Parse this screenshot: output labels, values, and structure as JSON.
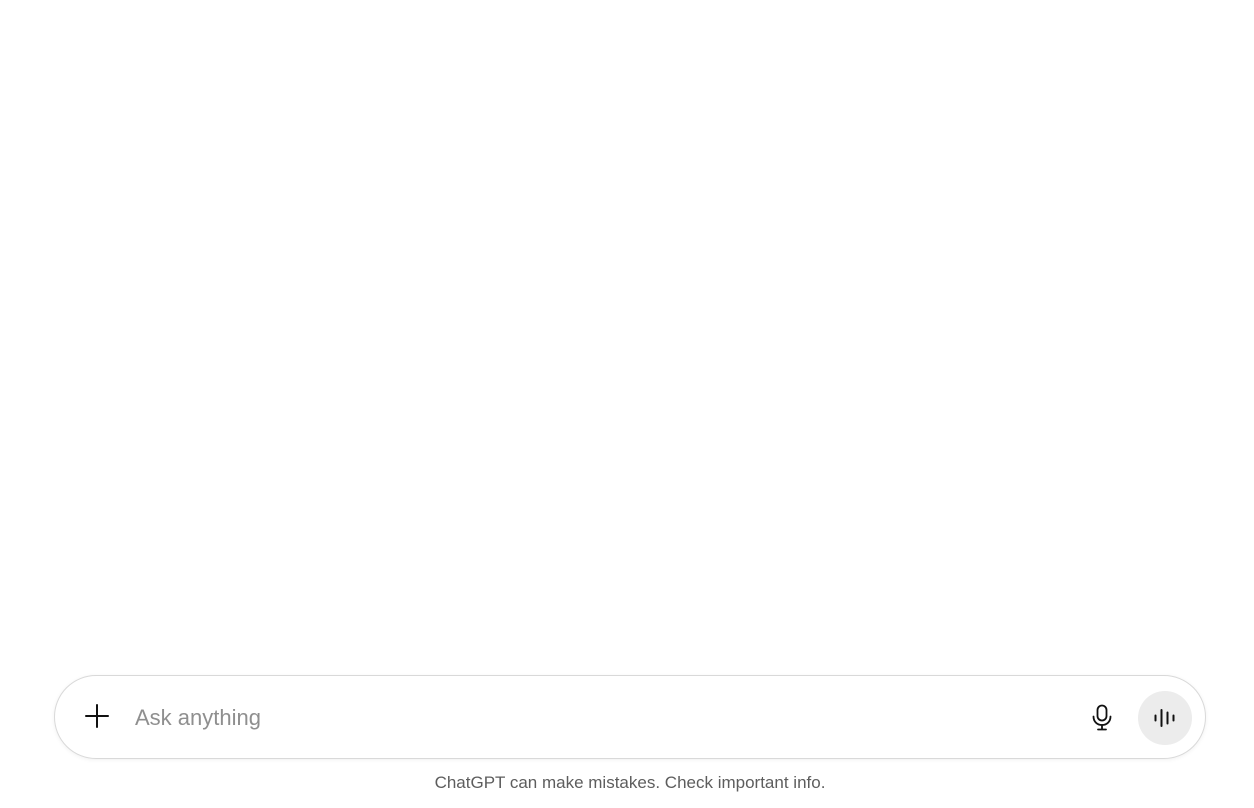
{
  "composer": {
    "placeholder": "Ask anything",
    "value": "",
    "add_icon": "plus-icon",
    "mic_icon": "microphone-icon",
    "voice_icon": "voice-waveform-icon"
  },
  "footer": {
    "disclaimer": "ChatGPT can make mistakes. Check important info."
  },
  "colors": {
    "background": "#ffffff",
    "composer_border": "#d9d9d9",
    "voice_button_bg": "#ececec",
    "placeholder_text": "#8f8f8f",
    "disclaimer_text": "#5d5d5d"
  }
}
